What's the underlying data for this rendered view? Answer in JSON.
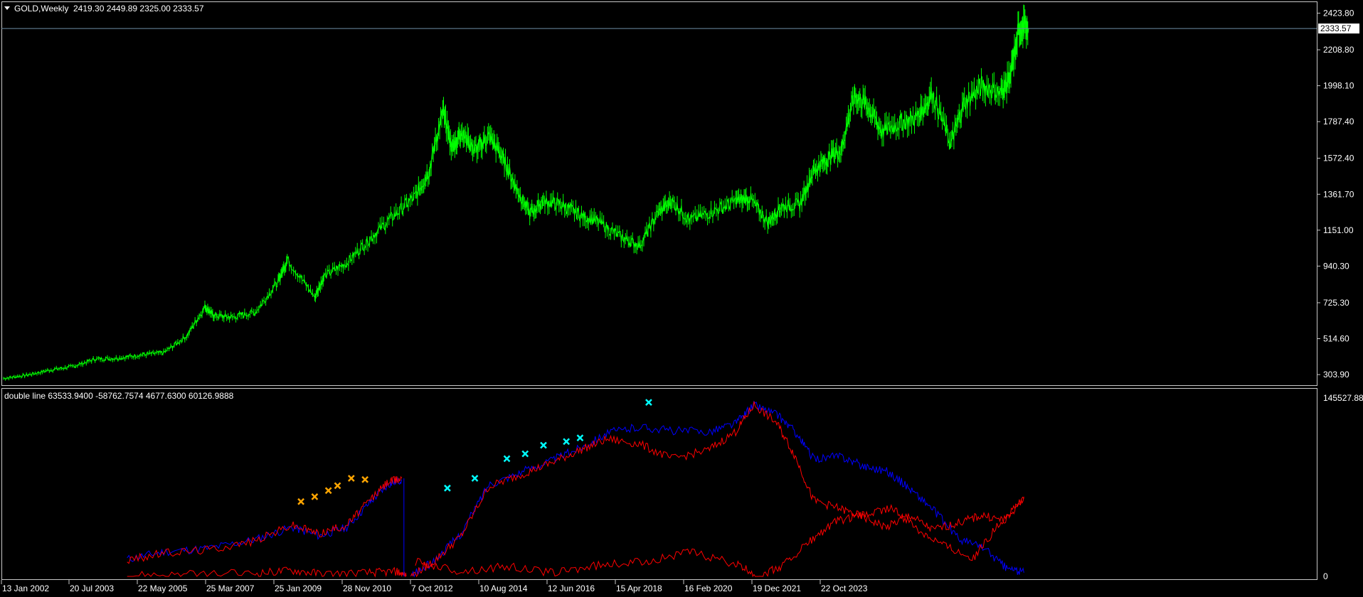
{
  "main_panel": {
    "symbol": "GOLD,Weekly",
    "ohlc": "2419.30 2449.89 2325.00 2333.57",
    "current_price": "2333.57",
    "y_ticks": [
      "2423.80",
      "2208.80",
      "1998.10",
      "1787.40",
      "1572.40",
      "1361.70",
      "1151.00",
      "940.30",
      "725.30",
      "514.60",
      "303.90"
    ]
  },
  "indicator_panel": {
    "title": "double line 63533.9400 -58762.7574 4677.6300 60126.9888",
    "y_ticks": [
      "145527.88",
      "0"
    ]
  },
  "x_axis": {
    "labels": [
      "13 Jan 2002",
      "20 Jul 2003",
      "22 May 2005",
      "25 Mar 2007",
      "25 Jan 2009",
      "28 Nov 2010",
      "7 Oct 2012",
      "10 Aug 2014",
      "12 Jun 2016",
      "15 Apr 2018",
      "16 Feb 2020",
      "19 Dec 2021",
      "22 Oct 2023"
    ]
  },
  "colors": {
    "background": "#000000",
    "price": "#00ff00",
    "axis": "#c8c8c8",
    "blue_line": "#0000ff",
    "red_line": "#ff0000",
    "cyan_marker": "#00ffff",
    "orange_marker": "#ffa500"
  },
  "chart_data": [
    {
      "type": "line",
      "title": "GOLD,Weekly",
      "ylim": [
        250,
        2480
      ],
      "xlim": [
        2002.0,
        2030.7
      ],
      "series": [
        {
          "x": [
            2002.0,
            2002.5,
            2003.0,
            2003.5,
            2004.0,
            2004.5,
            2005.0,
            2005.5,
            2006.0,
            2006.4,
            2006.6,
            2007.0,
            2007.5,
            2008.0,
            2008.2,
            2008.8,
            2009.0,
            2009.5,
            2010.0,
            2010.5,
            2011.0,
            2011.3,
            2011.6,
            2011.8,
            2012.0,
            2012.3,
            2012.6,
            2012.9,
            2013.2,
            2013.5,
            2013.8,
            2014.2,
            2014.6,
            2015.0,
            2015.5,
            2015.9,
            2016.3,
            2016.6,
            2017.0,
            2017.5,
            2018.0,
            2018.3,
            2018.7,
            2019.0,
            2019.4,
            2019.7,
            2020.0,
            2020.3,
            2020.6,
            2020.9,
            2021.2,
            2021.6,
            2022.0,
            2022.3,
            2022.7,
            2023.0,
            2023.4,
            2023.8,
            2024.0,
            2024.2,
            2024.4
          ],
          "values": [
            282,
            300,
            330,
            350,
            395,
            400,
            420,
            432,
            530,
            700,
            650,
            640,
            670,
            850,
            980,
            760,
            880,
            960,
            1100,
            1230,
            1350,
            1500,
            1850,
            1630,
            1730,
            1620,
            1700,
            1580,
            1400,
            1250,
            1320,
            1300,
            1240,
            1200,
            1110,
            1060,
            1250,
            1320,
            1210,
            1260,
            1320,
            1340,
            1200,
            1290,
            1300,
            1500,
            1570,
            1620,
            1950,
            1870,
            1730,
            1780,
            1820,
            1950,
            1660,
            1900,
            2000,
            1950,
            2050,
            2350,
            2333.57
          ]
        }
      ]
    },
    {
      "type": "line",
      "title": "double line 63533.9400 -58762.7574 4677.6300 60126.9888",
      "ylim": [
        0,
        145527.88
      ],
      "xlim": [
        2002.0,
        2030.7
      ],
      "series": [
        {
          "x": [
            2004.7,
            2005.5,
            2006.5,
            2007.5,
            2008.3,
            2008.9,
            2009.5,
            2010.0,
            2010.4,
            2010.7
          ],
          "values": [
            14000,
            20000,
            23000,
            30000,
            40000,
            33000,
            40000,
            60000,
            75000,
            79000
          ]
        },
        {
          "x": [
            2004.7,
            2005.5,
            2006.5,
            2007.5,
            2008.3,
            2008.9,
            2009.5,
            2010.0,
            2010.4,
            2010.7
          ],
          "values": [
            13000,
            19000,
            22000,
            29000,
            42000,
            35000,
            42000,
            62000,
            77000,
            80000
          ]
        },
        {
          "x": [
            2004.7,
            2006.0,
            2007.5,
            2008.3,
            2009.0,
            2010.0,
            2010.6,
            2010.8
          ],
          "values": [
            1000,
            1500,
            2500,
            5000,
            2000,
            3000,
            4000,
            0
          ]
        },
        {
          "x": [
            2010.9,
            2011.4,
            2012.0,
            2012.6,
            2013.3,
            2014.0,
            2014.6,
            2015.2,
            2015.9,
            2016.6,
            2017.4,
            2018.0,
            2018.4,
            2018.9,
            2019.3,
            2019.7,
            2020.3,
            2020.8,
            2021.3,
            2021.8,
            2022.3,
            2022.9,
            2023.4,
            2023.9,
            2024.3
          ],
          "values": [
            0,
            12000,
            35000,
            75000,
            85000,
            95000,
            105000,
            117000,
            122000,
            119000,
            118000,
            125000,
            140000,
            132000,
            118000,
            96000,
            98000,
            90000,
            86000,
            72000,
            55000,
            30000,
            24000,
            7000,
            3000
          ]
        },
        {
          "x": [
            2010.9,
            2011.4,
            2012.0,
            2012.6,
            2013.3,
            2014.0,
            2014.6,
            2015.2,
            2015.9,
            2016.6,
            2017.4,
            2018.0,
            2018.4,
            2018.9,
            2019.3,
            2019.7,
            2020.3,
            2020.8,
            2021.3,
            2021.8,
            2022.3,
            2022.9,
            2023.4,
            2023.9,
            2024.3
          ],
          "values": [
            0,
            12000,
            33000,
            73000,
            83000,
            93000,
            103000,
            112000,
            108000,
            96000,
            103000,
            118000,
            140000,
            125000,
            98000,
            62000,
            55000,
            48000,
            40000,
            50000,
            38000,
            44000,
            50000,
            45000,
            65000
          ]
        },
        {
          "x": [
            2011.0,
            2012.0,
            2013.0,
            2014.0,
            2015.0,
            2016.0,
            2017.0,
            2018.0,
            2018.5,
            2019.0,
            2019.6,
            2020.2,
            2020.8,
            2021.4,
            2022.0,
            2022.6,
            2023.2,
            2023.8,
            2024.3
          ],
          "values": [
            12000,
            4000,
            8000,
            3000,
            9000,
            12000,
            20000,
            10000,
            0,
            8000,
            28000,
            45000,
            50000,
            56000,
            38000,
            25000,
            15000,
            45000,
            63000
          ]
        }
      ],
      "markers": [
        {
          "color": "orange",
          "x": [
            2008.5,
            2008.8,
            2009.1,
            2009.3,
            2009.6,
            2009.9
          ],
          "values": [
            61000,
            65000,
            70000,
            74000,
            80000,
            79000
          ]
        },
        {
          "color": "cyan",
          "x": [
            2011.7,
            2012.3,
            2013.0,
            2013.4,
            2013.8,
            2014.3,
            2014.6,
            2016.1
          ],
          "values": [
            72000,
            80000,
            96000,
            100000,
            107000,
            110000,
            113000,
            142000
          ]
        }
      ]
    }
  ]
}
